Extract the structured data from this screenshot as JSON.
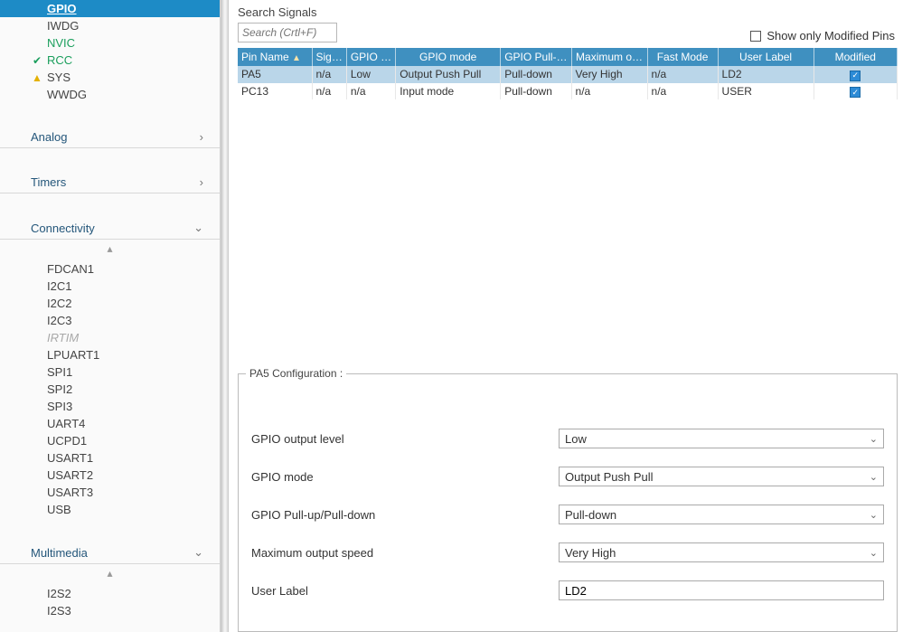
{
  "sidebar": {
    "systemCore": [
      {
        "label": "GPIO",
        "state": "selected"
      },
      {
        "label": "IWDG",
        "state": "normal"
      },
      {
        "label": "NVIC",
        "state": "green"
      },
      {
        "label": "RCC",
        "state": "green",
        "icon": "check"
      },
      {
        "label": "SYS",
        "state": "normal",
        "icon": "warn"
      },
      {
        "label": "WWDG",
        "state": "normal"
      }
    ],
    "sections": {
      "analog": "Analog",
      "timers": "Timers",
      "connectivity": "Connectivity",
      "multimedia": "Multimedia"
    },
    "connectivity": [
      {
        "label": "FDCAN1"
      },
      {
        "label": "I2C1"
      },
      {
        "label": "I2C2"
      },
      {
        "label": "I2C3"
      },
      {
        "label": "IRTIM",
        "disabled": true
      },
      {
        "label": "LPUART1"
      },
      {
        "label": "SPI1"
      },
      {
        "label": "SPI2"
      },
      {
        "label": "SPI3"
      },
      {
        "label": "UART4"
      },
      {
        "label": "UCPD1"
      },
      {
        "label": "USART1"
      },
      {
        "label": "USART2"
      },
      {
        "label": "USART3"
      },
      {
        "label": "USB"
      }
    ],
    "multimedia": [
      {
        "label": "I2S2"
      },
      {
        "label": "I2S3"
      }
    ]
  },
  "search": {
    "label": "Search Signals",
    "placeholder": "Search (Crtl+F)"
  },
  "showModified": "Show only Modified Pins",
  "table": {
    "headers": {
      "pin": "Pin Name",
      "sig": "Sig…",
      "gpioOut": "GPIO …",
      "mode": "GPIO mode",
      "pull": "GPIO Pull-…",
      "max": "Maximum o…",
      "fast": "Fast Mode",
      "label": "User Label",
      "modified": "Modified"
    },
    "rows": [
      {
        "pin": "PA5",
        "sig": "n/a",
        "gpioOut": "Low",
        "mode": "Output Push Pull",
        "pull": "Pull-down",
        "max": "Very High",
        "fast": "n/a",
        "label": "LD2",
        "sel": true
      },
      {
        "pin": "PC13",
        "sig": "n/a",
        "gpioOut": "n/a",
        "mode": "Input mode",
        "pull": "Pull-down",
        "max": "n/a",
        "fast": "n/a",
        "label": "USER",
        "sel": false
      }
    ]
  },
  "config": {
    "title": "PA5 Configuration :",
    "rows": {
      "outLevel": {
        "label": "GPIO output level",
        "value": "Low"
      },
      "mode": {
        "label": "GPIO mode",
        "value": "Output Push Pull"
      },
      "pull": {
        "label": "GPIO Pull-up/Pull-down",
        "value": "Pull-down"
      },
      "speed": {
        "label": "Maximum output speed",
        "value": "Very High"
      },
      "userLabel": {
        "label": "User Label",
        "value": "LD2"
      }
    }
  }
}
